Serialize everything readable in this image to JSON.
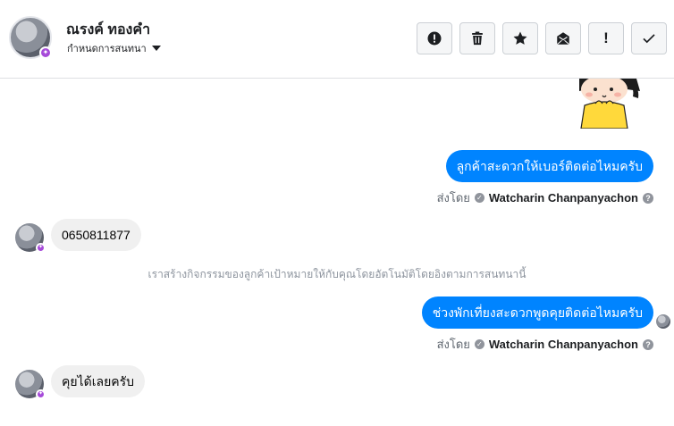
{
  "contact": {
    "name": "ณรงค์ ทองคำ",
    "subtitle": "กำหนดการสนทนา"
  },
  "toolbar": [
    {
      "name": "report-button",
      "icon": "alert-circle-icon"
    },
    {
      "name": "delete-button",
      "icon": "trash-icon"
    },
    {
      "name": "star-button",
      "icon": "star-icon"
    },
    {
      "name": "mark-unread-button",
      "icon": "envelope-open-icon"
    },
    {
      "name": "priority-button",
      "icon": "exclamation-icon",
      "label": "!"
    },
    {
      "name": "done-button",
      "icon": "checkmark-icon"
    }
  ],
  "messages": {
    "m1": {
      "text": "ลูกค้าสะดวกให้เบอร์ติดต่อไหมครับ",
      "sent_by_label": "ส่งโดย",
      "sender": "Watcharin Chanpanyachon"
    },
    "m2": {
      "text": "0650811877"
    },
    "system": "เราสร้างกิจกรรมของลูกค้าเป้าหมายให้กับคุณโดยอัตโนมัติโดยอิงตามการสนทนานี้",
    "m3": {
      "text": "ช่วงพักเที่ยงสะดวกพูดคุยติดต่อไหมครับ",
      "sent_by_label": "ส่งโดย",
      "sender": "Watcharin Chanpanyachon"
    },
    "m4": {
      "text": "คุยได้เลยครับ"
    }
  },
  "colors": {
    "outgoing": "#0084ff",
    "incoming": "#f0f0f0",
    "badge": "#a64ad9"
  }
}
